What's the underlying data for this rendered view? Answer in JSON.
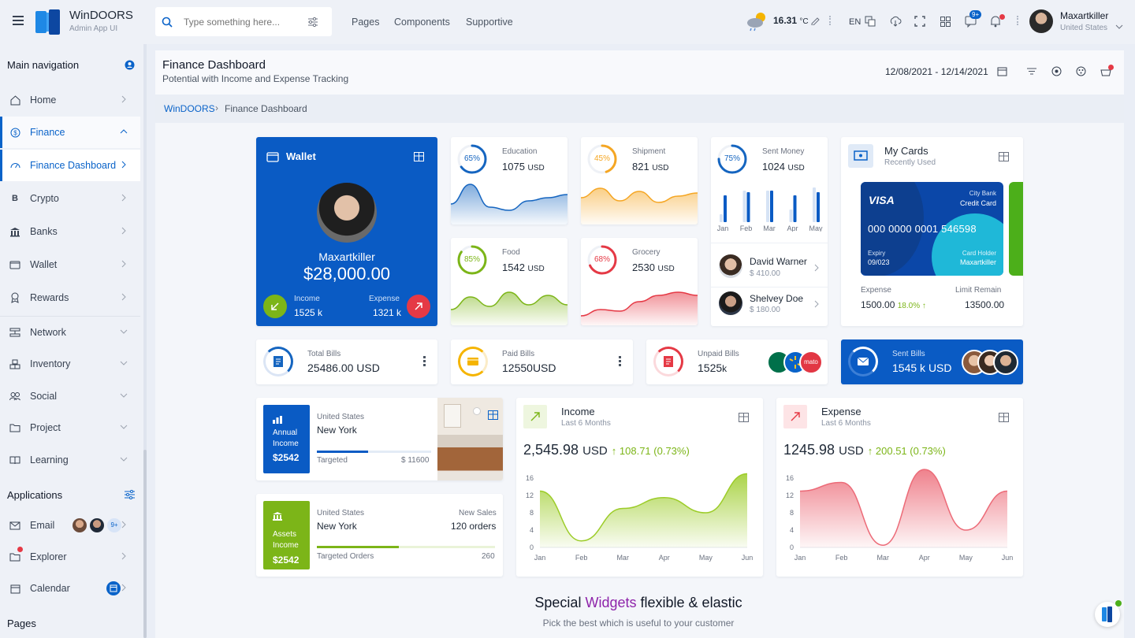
{
  "app": {
    "name": "WinDOORS",
    "subtitle": "Admin App UI"
  },
  "search": {
    "placeholder": "Type something here..."
  },
  "topnav": [
    "Pages",
    "Components",
    "Supportive"
  ],
  "weather": {
    "temp": "16.31",
    "unit": "°C"
  },
  "lang": "EN",
  "notification_badge": "9+",
  "user": {
    "name": "Maxartkiller",
    "country": "United States"
  },
  "sidebar": {
    "main_title": "Main navigation",
    "items": [
      {
        "label": "Home"
      },
      {
        "label": "Finance"
      },
      {
        "label": "Finance Dashboard"
      },
      {
        "label": "Crypto"
      },
      {
        "label": "Banks"
      },
      {
        "label": "Wallet"
      },
      {
        "label": "Rewards"
      },
      {
        "label": "Network"
      },
      {
        "label": "Inventory"
      },
      {
        "label": "Social"
      },
      {
        "label": "Project"
      },
      {
        "label": "Learning"
      }
    ],
    "apps_title": "Applications",
    "apps": [
      {
        "label": "Email",
        "badge": "9+"
      },
      {
        "label": "Explorer"
      },
      {
        "label": "Calendar"
      }
    ],
    "pages_title": "Pages"
  },
  "page": {
    "title": "Finance Dashboard",
    "subtitle": "Potential with Income and Expense Tracking",
    "date_range": "12/08/2021 - 12/14/2021",
    "breadcrumb": [
      "WinDOORS",
      "Finance Dashboard"
    ]
  },
  "wallet": {
    "title": "Wallet",
    "name": "Maxartkiller",
    "amount": "$28,000.00",
    "income_label": "Income",
    "income": "1525 k",
    "expense_label": "Expense",
    "expense": "1321 k"
  },
  "stats": [
    {
      "pct": "65%",
      "label": "Education",
      "value": "1075",
      "unit": "USD",
      "fraction": 0.65,
      "color": "#1565c0"
    },
    {
      "pct": "45%",
      "label": "Shipment",
      "value": "821",
      "unit": "USD",
      "fraction": 0.45,
      "color": "#f5a623"
    },
    {
      "pct": "85%",
      "label": "Food",
      "value": "1542",
      "unit": "USD",
      "fraction": 0.85,
      "color": "#7cb518"
    },
    {
      "pct": "68%",
      "label": "Grocery",
      "value": "2530",
      "unit": "USD",
      "fraction": 0.68,
      "color": "#e53945"
    }
  ],
  "sent_money": {
    "pct": "75%",
    "fraction": 0.75,
    "label": "Sent Money",
    "value": "1024",
    "unit": "USD",
    "months": [
      "Jan",
      "Feb",
      "Mar",
      "Apr",
      "May"
    ]
  },
  "contacts": [
    {
      "name": "David Warner",
      "amount": "$ 410.00"
    },
    {
      "name": "Shelvey Doe",
      "amount": "$ 180.00"
    }
  ],
  "my_cards": {
    "title": "My Cards",
    "subtitle": "Recently Used",
    "card": {
      "brand": "VISA",
      "bank": "City Bank",
      "type": "Credit Card",
      "number": "000 0000 0001 546598",
      "expiry_label": "Expiry",
      "expiry": "09/023",
      "holder_label": "Card Holder",
      "holder": "Maxartkiller"
    },
    "expense_label": "Expense",
    "expense": "1500.00",
    "expense_change": "18.0% ↑",
    "limit_label": "Limit Remain",
    "limit": "13500.00"
  },
  "bills": [
    {
      "label": "Total Bills",
      "value": "25486.00",
      "unit": "USD"
    },
    {
      "label": "Paid Bills",
      "value": "12550",
      "unit": "USD"
    },
    {
      "label": "Unpaid Bills",
      "value": "1525",
      "unit": "k"
    },
    {
      "label": "Sent Bills",
      "value": "1545 k",
      "unit": "USD"
    }
  ],
  "unpaid_logos": {
    "third": "mato"
  },
  "annual": {
    "badge_line1": "Annual",
    "badge_line2": "Income",
    "badge_value": "$2542",
    "country": "United States",
    "city": "New York",
    "target_label": "Targeted",
    "target_value": "$ 11600",
    "progress": 0.45
  },
  "assets": {
    "badge_line1": "Assets",
    "badge_line2": "Income",
    "badge_value": "$2542",
    "country": "United States",
    "city": "New York",
    "sales_label": "New Sales",
    "sales_value": "120 orders",
    "target_label": "Targeted Orders",
    "target_value": "260",
    "progress": 0.46
  },
  "income_card": {
    "title": "Income",
    "subtitle": "Last 6 Months",
    "amount": "2,545.98",
    "unit": "USD",
    "change": "↑ 108.71 (0.73%)"
  },
  "expense_card": {
    "title": "Expense",
    "subtitle": "Last 6 Months",
    "amount": "1245.98",
    "unit": "USD",
    "change": "↑ 200.51 (0.73%)"
  },
  "chart_data": [
    {
      "type": "area",
      "x": [
        "Jan",
        "Feb",
        "Mar",
        "Apr",
        "May",
        "Jun"
      ],
      "yticks": [
        0,
        4,
        8,
        12,
        16
      ],
      "ylim": [
        0,
        16
      ],
      "series": [
        {
          "values": [
            13,
            1.5,
            9,
            11.5,
            8,
            17
          ]
        }
      ],
      "color": "#9ccc28"
    },
    {
      "type": "area",
      "x": [
        "Jan",
        "Feb",
        "Mar",
        "Apr",
        "May",
        "Jun"
      ],
      "yticks": [
        0,
        4,
        8,
        12,
        16
      ],
      "ylim": [
        0,
        16
      ],
      "series": [
        {
          "values": [
            13,
            15,
            0.5,
            18,
            4,
            13
          ]
        }
      ],
      "color": "#ec6b78"
    }
  ],
  "footer": {
    "heading_pre": "Special",
    "heading_accent": "Widgets",
    "heading_post": "flexible & elastic",
    "sub": "Pick the best which is useful to your customer"
  }
}
